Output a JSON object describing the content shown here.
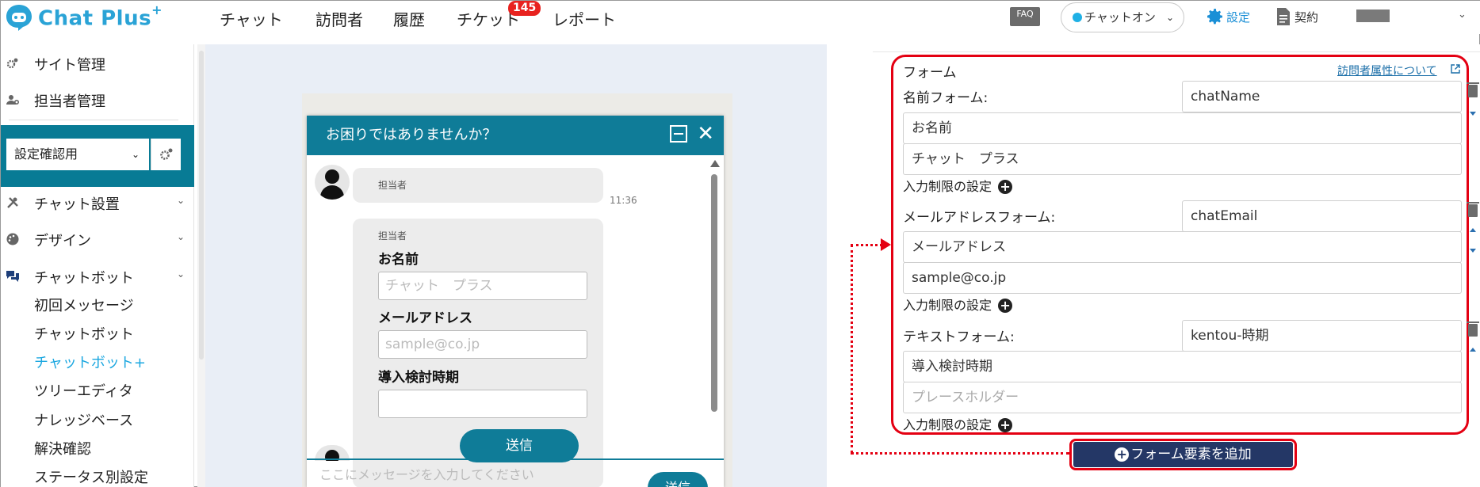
{
  "app": {
    "brand": "Chat Plus",
    "brand_suffix": "+"
  },
  "nav": {
    "items": [
      {
        "label": "チャット"
      },
      {
        "label": "訪問者"
      },
      {
        "label": "履歴"
      },
      {
        "label": "チケット"
      },
      {
        "label": "レポート"
      }
    ],
    "ticket_badge": "145"
  },
  "header": {
    "faq": "FAQ",
    "chat_status": "チャットオン",
    "settings": "設定",
    "contract": "契約"
  },
  "sidebar": {
    "top_items": [
      {
        "label": "サイト管理"
      },
      {
        "label": "担当者管理"
      }
    ],
    "site_select": "設定確認用",
    "sections": [
      {
        "label": "チャット設置"
      },
      {
        "label": "デザイン"
      },
      {
        "label": "チャットボット"
      }
    ],
    "sub_items": [
      {
        "label": "初回メッセージ",
        "active": false
      },
      {
        "label": "チャットボット",
        "active": false
      },
      {
        "label": "チャットボット+",
        "active": true
      },
      {
        "label": "ツリーエディタ",
        "active": false
      },
      {
        "label": "ナレッジベース",
        "active": false
      },
      {
        "label": "解決確認",
        "active": false
      },
      {
        "label": "ステータス別設定",
        "active": false
      }
    ]
  },
  "widget": {
    "title": "お困りではありませんか？",
    "agent_label_1": "担当者",
    "time_1": "11:36",
    "agent_label_2": "担当者",
    "fields": [
      {
        "label": "お名前",
        "placeholder": "チャット　プラス"
      },
      {
        "label": "メールアドレス",
        "placeholder": "sample@co.jp"
      },
      {
        "label": "導入検討時期",
        "placeholder": ""
      }
    ],
    "submit": "送信",
    "input_placeholder": "ここにメッセージを入力してください",
    "send": "送信"
  },
  "form_editor": {
    "title": "フォーム",
    "attr_link": "訪問者属性について",
    "rows": [
      {
        "label": "名前フォーム:",
        "key": "chatName",
        "name_value": "お名前",
        "placeholder_value": "チャット　プラス",
        "placeholder_is_hint": false,
        "limit": "入力制限の設定"
      },
      {
        "label": "メールアドレスフォーム:",
        "key": "chatEmail",
        "name_value": "メールアドレス",
        "placeholder_value": "sample@co.jp",
        "placeholder_is_hint": false,
        "limit": "入力制限の設定"
      },
      {
        "label": "テキストフォーム:",
        "key": "kentou-時期",
        "name_value": "導入検討時期",
        "placeholder_value": "プレースホルダー",
        "placeholder_is_hint": true,
        "limit": "入力制限の設定"
      }
    ],
    "add_button": "フォーム要素を追加"
  },
  "colors": {
    "brand": "#2aa3d6",
    "widget_header": "#0f7c98",
    "highlight": "#e40012",
    "add_button": "#243766",
    "active_link": "#1ba7e0"
  }
}
